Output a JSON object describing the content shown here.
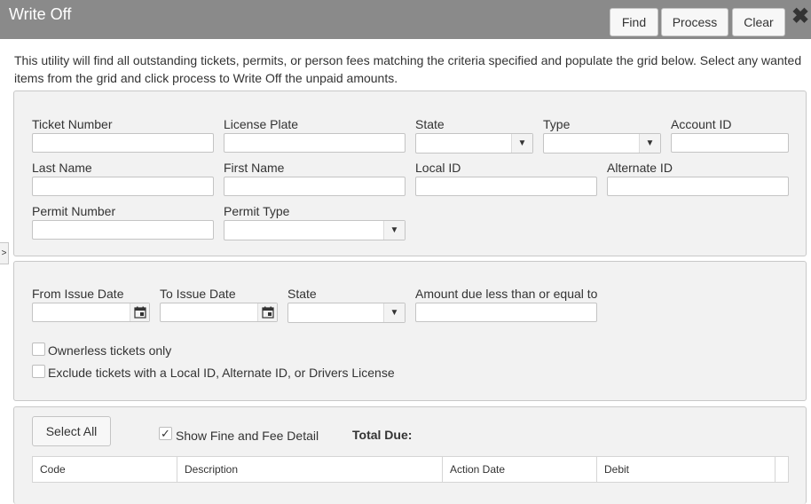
{
  "window": {
    "title": "Write Off",
    "buttons": {
      "find": "Find",
      "process": "Process",
      "clear": "Clear"
    },
    "close_icon": "close-icon"
  },
  "description": "This utility will find all outstanding tickets, permits, or person fees matching the criteria specified and populate the grid below. Select any wanted items from the grid and click process to Write Off the unpaid amounts.",
  "search": {
    "ticket_number": {
      "label": "Ticket Number",
      "value": ""
    },
    "license_plate": {
      "label": "License Plate",
      "value": ""
    },
    "state": {
      "label": "State",
      "value": ""
    },
    "type": {
      "label": "Type",
      "value": ""
    },
    "account_id": {
      "label": "Account ID",
      "value": ""
    },
    "last_name": {
      "label": "Last Name",
      "value": ""
    },
    "first_name": {
      "label": "First Name",
      "value": ""
    },
    "local_id": {
      "label": "Local ID",
      "value": ""
    },
    "alternate_id": {
      "label": "Alternate ID",
      "value": ""
    },
    "permit_number": {
      "label": "Permit Number",
      "value": ""
    },
    "permit_type": {
      "label": "Permit Type",
      "value": ""
    }
  },
  "filters": {
    "from_issue_date": {
      "label": "From Issue Date",
      "value": ""
    },
    "to_issue_date": {
      "label": "To Issue Date",
      "value": ""
    },
    "state": {
      "label": "State",
      "value": ""
    },
    "amount_due": {
      "label": "Amount due less than or equal to",
      "value": ""
    },
    "ownerless_only": {
      "label": "Ownerless tickets only",
      "checked": false
    },
    "exclude_ids": {
      "label": "Exclude tickets with a Local ID, Alternate ID, or Drivers License",
      "checked": false
    }
  },
  "results": {
    "select_all": "Select All",
    "show_fine_detail": {
      "label": "Show Fine and Fee Detail",
      "checked": true
    },
    "total_due_label": "Total Due:",
    "total_due_value": "",
    "columns": [
      "Code",
      "Description",
      "Action Date",
      "Debit"
    ]
  },
  "side_toggle": ">",
  "icons": {
    "dropdown": "chevron-down-icon",
    "calendar": "calendar-icon",
    "check": "checkmark-icon"
  }
}
